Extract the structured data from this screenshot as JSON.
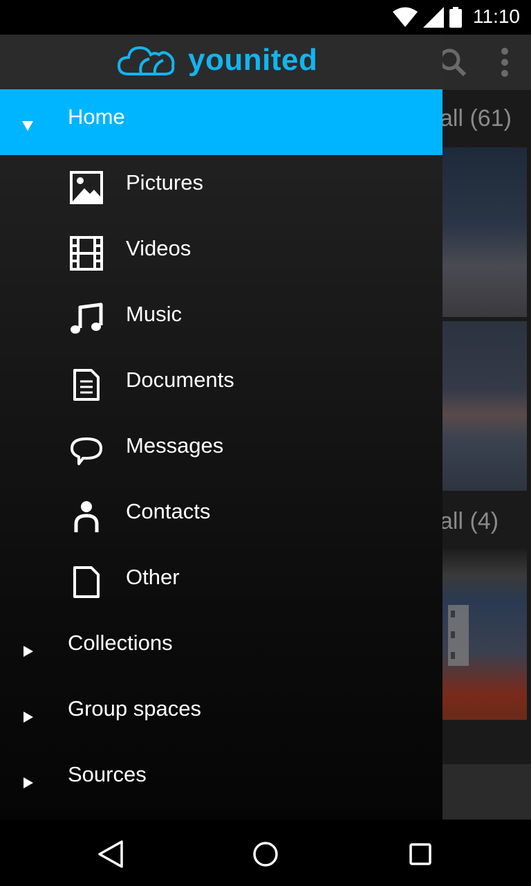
{
  "status_bar": {
    "time": "11:10"
  },
  "app": {
    "brand": "younited",
    "brand_color": "#12b5ef",
    "accent_color": "#00b5ff"
  },
  "drawer": {
    "home": {
      "label": "Home",
      "expanded": true
    },
    "sub_items": [
      {
        "label": "Pictures",
        "icon": "picture-icon"
      },
      {
        "label": "Videos",
        "icon": "film-icon"
      },
      {
        "label": "Music",
        "icon": "music-note-icon"
      },
      {
        "label": "Documents",
        "icon": "document-icon"
      },
      {
        "label": "Messages",
        "icon": "speech-bubble-icon"
      },
      {
        "label": "Contacts",
        "icon": "person-icon"
      },
      {
        "label": "Other",
        "icon": "file-icon"
      }
    ],
    "sections": [
      {
        "label": "Collections"
      },
      {
        "label": "Group spaces"
      },
      {
        "label": "Sources"
      }
    ]
  },
  "background": {
    "view_all_1": "all (61)",
    "view_all_2": "all (4)"
  }
}
